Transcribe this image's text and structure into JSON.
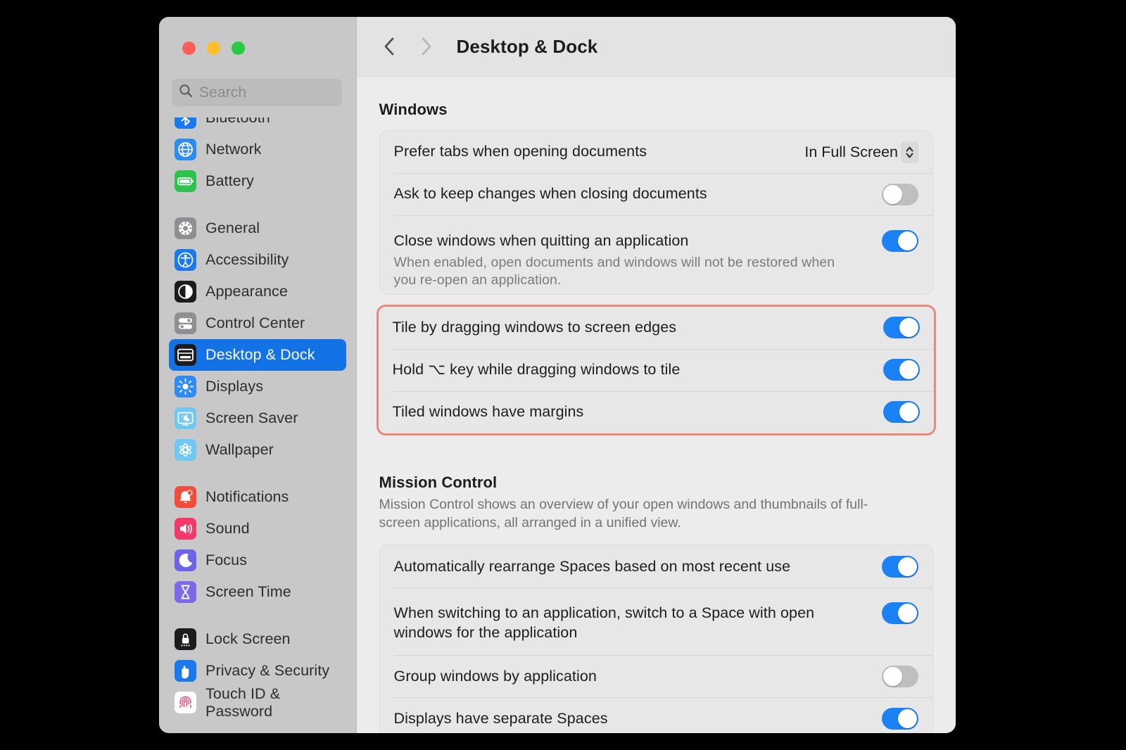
{
  "window": {
    "title": "Desktop & Dock",
    "traffic_lights": [
      {
        "name": "close",
        "color": "#fb5f57"
      },
      {
        "name": "minimize",
        "color": "#fcbd2e"
      },
      {
        "name": "zoom",
        "color": "#27ca41"
      }
    ],
    "nav": {
      "back": "‹",
      "forward": "›"
    }
  },
  "search": {
    "placeholder": "Search",
    "value": ""
  },
  "sidebar": {
    "groups": [
      {
        "items": [
          {
            "label": "Bluetooth",
            "icon": "bluetooth-icon",
            "selected": false
          },
          {
            "label": "Network",
            "icon": "network-icon",
            "selected": false
          },
          {
            "label": "Battery",
            "icon": "battery-icon",
            "selected": false
          }
        ]
      },
      {
        "items": [
          {
            "label": "General",
            "icon": "gear-icon",
            "selected": false
          },
          {
            "label": "Accessibility",
            "icon": "accessibility-icon",
            "selected": false
          },
          {
            "label": "Appearance",
            "icon": "appearance-icon",
            "selected": false
          },
          {
            "label": "Control Center",
            "icon": "control-center-icon",
            "selected": false
          },
          {
            "label": "Desktop & Dock",
            "icon": "desktop-dock-icon",
            "selected": true
          },
          {
            "label": "Displays",
            "icon": "displays-icon",
            "selected": false
          },
          {
            "label": "Screen Saver",
            "icon": "screen-saver-icon",
            "selected": false
          },
          {
            "label": "Wallpaper",
            "icon": "wallpaper-icon",
            "selected": false
          }
        ]
      },
      {
        "items": [
          {
            "label": "Notifications",
            "icon": "notifications-icon",
            "selected": false
          },
          {
            "label": "Sound",
            "icon": "sound-icon",
            "selected": false
          },
          {
            "label": "Focus",
            "icon": "focus-icon",
            "selected": false
          },
          {
            "label": "Screen Time",
            "icon": "screen-time-icon",
            "selected": false
          }
        ]
      },
      {
        "items": [
          {
            "label": "Lock Screen",
            "icon": "lock-screen-icon",
            "selected": false
          },
          {
            "label": "Privacy & Security",
            "icon": "privacy-security-icon",
            "selected": false
          },
          {
            "label": "Touch ID & Password",
            "icon": "touch-id-icon",
            "selected": false
          }
        ]
      }
    ]
  },
  "main": {
    "windows_section": {
      "heading": "Windows",
      "rows": [
        {
          "label": "Prefer tabs when opening documents",
          "control": "popup",
          "value": "In Full Screen"
        },
        {
          "label": "Ask to keep changes when closing documents",
          "control": "toggle",
          "value": "off"
        },
        {
          "label": "Close windows when quitting an application",
          "sublabel": "When enabled, open documents and windows will not be restored when you re-open an application.",
          "control": "toggle",
          "value": "on"
        }
      ]
    },
    "tiling_section": {
      "highlighted": true,
      "highlight_color": "#e9887c",
      "rows": [
        {
          "label": "Tile by dragging windows to screen edges",
          "control": "toggle",
          "value": "on"
        },
        {
          "label": "Hold ⌥ key while dragging windows to tile",
          "control": "toggle",
          "value": "on"
        },
        {
          "label": "Tiled windows have margins",
          "control": "toggle",
          "value": "on"
        }
      ]
    },
    "mission_control_section": {
      "heading": "Mission Control",
      "description": "Mission Control shows an overview of your open windows and thumbnails of full-screen applications, all arranged in a unified view.",
      "rows": [
        {
          "label": "Automatically rearrange Spaces based on most recent use",
          "control": "toggle",
          "value": "on"
        },
        {
          "label": "When switching to an application, switch to a Space with open windows for the application",
          "control": "toggle",
          "value": "on"
        },
        {
          "label": "Group windows by application",
          "control": "toggle",
          "value": "off"
        },
        {
          "label": "Displays have separate Spaces",
          "control": "toggle",
          "value": "on"
        }
      ]
    }
  },
  "colors": {
    "accent": "#1373e6",
    "toggle_on": "#1b82f5",
    "toggle_off": "#bfbfbf",
    "highlight_border": "#e9887c"
  }
}
